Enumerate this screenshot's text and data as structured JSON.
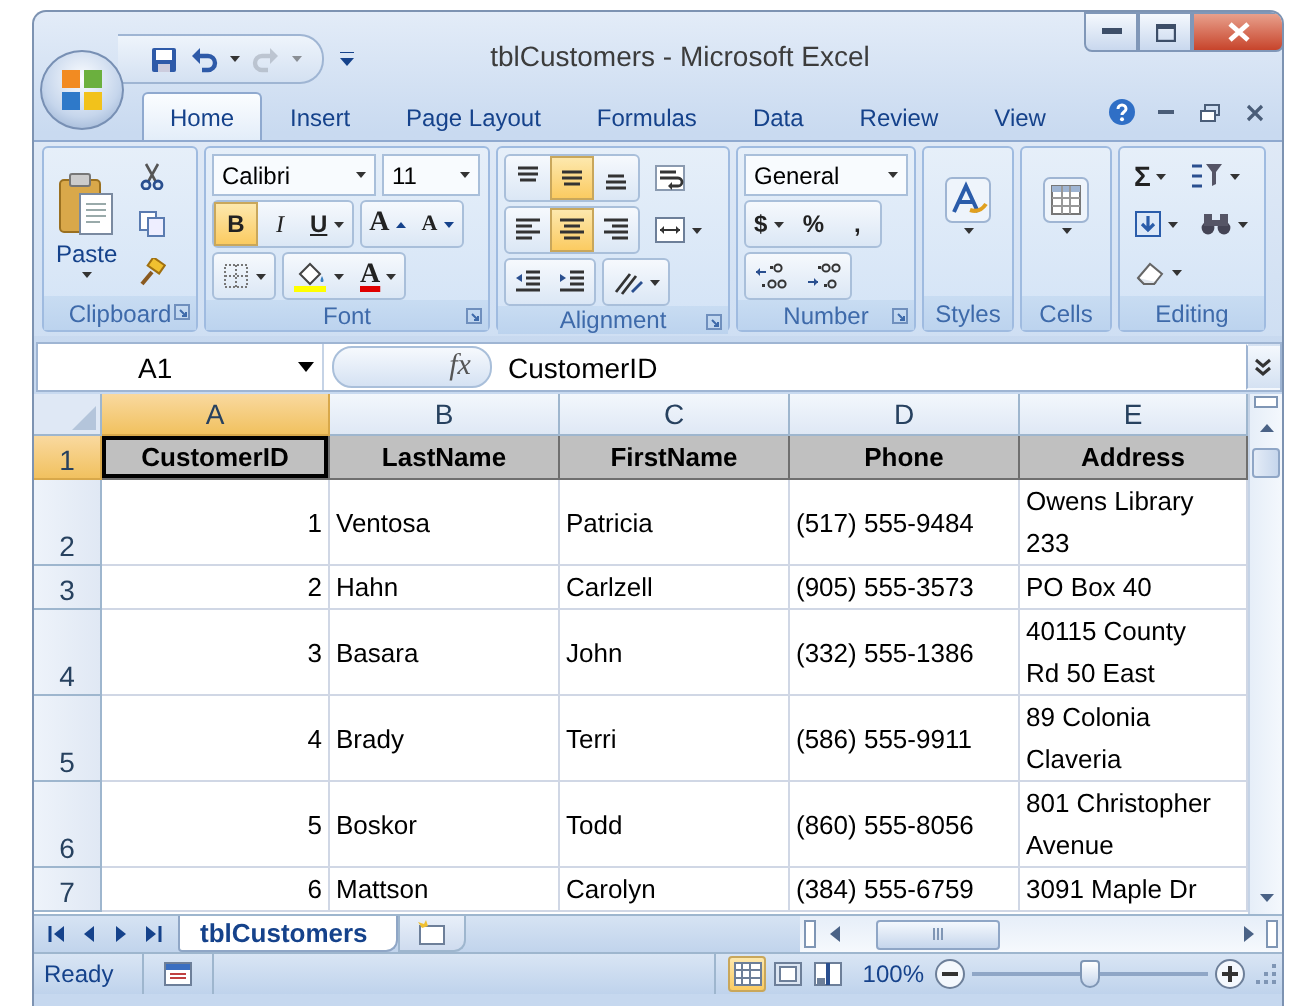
{
  "window": {
    "title": "tblCustomers - Microsoft Excel"
  },
  "quick_access": [
    {
      "kind": "save",
      "disabled": false
    },
    {
      "kind": "undo",
      "disabled": false
    },
    {
      "kind": "redo",
      "disabled": true
    }
  ],
  "tabs": [
    {
      "label": "Home",
      "selected": true
    },
    {
      "label": "Insert",
      "selected": false
    },
    {
      "label": "Page Layout",
      "selected": false
    },
    {
      "label": "Formulas",
      "selected": false
    },
    {
      "label": "Data",
      "selected": false
    },
    {
      "label": "Review",
      "selected": false
    },
    {
      "label": "View",
      "selected": false
    }
  ],
  "ribbon": {
    "clipboard": {
      "label": "Clipboard",
      "paste": "Paste"
    },
    "font": {
      "label": "Font",
      "font_name": "Calibri",
      "font_size": "11",
      "styles": [
        {
          "kind": "bold",
          "text": "B",
          "on": true
        },
        {
          "kind": "italic",
          "text": "I",
          "on": false
        },
        {
          "kind": "underline",
          "text": "U",
          "on": false
        }
      ],
      "grow": "A",
      "shrink": "A",
      "font_color": "A"
    },
    "alignment": {
      "label": "Alignment",
      "vertical": [
        {
          "kind": "top",
          "on": false
        },
        {
          "kind": "middle",
          "on": true
        },
        {
          "kind": "bottom",
          "on": false
        }
      ],
      "horizontal": [
        {
          "kind": "left",
          "on": false
        },
        {
          "kind": "center",
          "on": true
        },
        {
          "kind": "right",
          "on": false
        }
      ]
    },
    "number": {
      "label": "Number",
      "format": "General",
      "symbols": [
        "$",
        "%",
        ","
      ]
    },
    "styles": {
      "label": "Styles"
    },
    "cells": {
      "label": "Cells"
    },
    "editing": {
      "label": "Editing",
      "sum": "Σ"
    }
  },
  "formula_bar": {
    "name_box": "A1",
    "fx": "fx",
    "content": "CustomerID"
  },
  "sheet": {
    "columns": [
      {
        "letter": "A",
        "selected": true
      },
      {
        "letter": "B",
        "selected": false
      },
      {
        "letter": "C",
        "selected": false
      },
      {
        "letter": "D",
        "selected": false
      },
      {
        "letter": "E",
        "selected": false
      }
    ],
    "rows": [
      {
        "number": "1",
        "selected": true,
        "cells": [
          {
            "text": "CustomerID",
            "kind": "header",
            "active": true
          },
          {
            "text": "LastName",
            "kind": "header",
            "active": false
          },
          {
            "text": "FirstName",
            "kind": "header",
            "active": false
          },
          {
            "text": "Phone",
            "kind": "header",
            "active": false
          },
          {
            "text": "Address",
            "kind": "header",
            "active": false
          }
        ]
      },
      {
        "number": "2",
        "selected": false,
        "cells": [
          {
            "text": "1",
            "kind": "number",
            "active": false
          },
          {
            "text": "Ventosa",
            "kind": "text",
            "active": false
          },
          {
            "text": "Patricia",
            "kind": "text",
            "active": false
          },
          {
            "text": "(517) 555-9484",
            "kind": "text",
            "active": false
          },
          {
            "text": "Owens Library 233",
            "kind": "text",
            "active": false
          }
        ]
      },
      {
        "number": "3",
        "selected": false,
        "cells": [
          {
            "text": "2",
            "kind": "number",
            "active": false
          },
          {
            "text": "Hahn",
            "kind": "text",
            "active": false
          },
          {
            "text": "Carlzell",
            "kind": "text",
            "active": false
          },
          {
            "text": "(905) 555-3573",
            "kind": "text",
            "active": false
          },
          {
            "text": "PO Box 40",
            "kind": "text",
            "active": false
          }
        ]
      },
      {
        "number": "4",
        "selected": false,
        "cells": [
          {
            "text": "3",
            "kind": "number",
            "active": false
          },
          {
            "text": "Basara",
            "kind": "text",
            "active": false
          },
          {
            "text": "John",
            "kind": "text",
            "active": false
          },
          {
            "text": "(332) 555-1386",
            "kind": "text",
            "active": false
          },
          {
            "text": "40115 County Rd 50 East",
            "kind": "text",
            "active": false
          }
        ]
      },
      {
        "number": "5",
        "selected": false,
        "cells": [
          {
            "text": "4",
            "kind": "number",
            "active": false
          },
          {
            "text": "Brady",
            "kind": "text",
            "active": false
          },
          {
            "text": "Terri",
            "kind": "text",
            "active": false
          },
          {
            "text": "(586) 555-9911",
            "kind": "text",
            "active": false
          },
          {
            "text": "89 Colonia Claveria",
            "kind": "text",
            "active": false
          }
        ]
      },
      {
        "number": "6",
        "selected": false,
        "cells": [
          {
            "text": "5",
            "kind": "number",
            "active": false
          },
          {
            "text": "Boskor",
            "kind": "text",
            "active": false
          },
          {
            "text": "Todd",
            "kind": "text",
            "active": false
          },
          {
            "text": "(860) 555-8056",
            "kind": "text",
            "active": false
          },
          {
            "text": "801 Christopher Avenue",
            "kind": "text",
            "active": false
          }
        ]
      },
      {
        "number": "7",
        "selected": false,
        "cells": [
          {
            "text": "6",
            "kind": "number",
            "active": false
          },
          {
            "text": "Mattson",
            "kind": "text",
            "active": false
          },
          {
            "text": "Carolyn",
            "kind": "text",
            "active": false
          },
          {
            "text": "(384) 555-6759",
            "kind": "text",
            "active": false
          },
          {
            "text": "3091 Maple Dr",
            "kind": "text",
            "active": false
          }
        ]
      }
    ]
  },
  "sheet_tabs": [
    {
      "label": "tblCustomers",
      "selected": true
    }
  ],
  "status_bar": {
    "text": "Ready",
    "views": [
      {
        "kind": "normal",
        "selected": true
      },
      {
        "kind": "layout",
        "selected": false
      },
      {
        "kind": "break",
        "selected": false
      }
    ],
    "zoom": "100%",
    "zoom_slider": {
      "level": 0.5
    }
  }
}
